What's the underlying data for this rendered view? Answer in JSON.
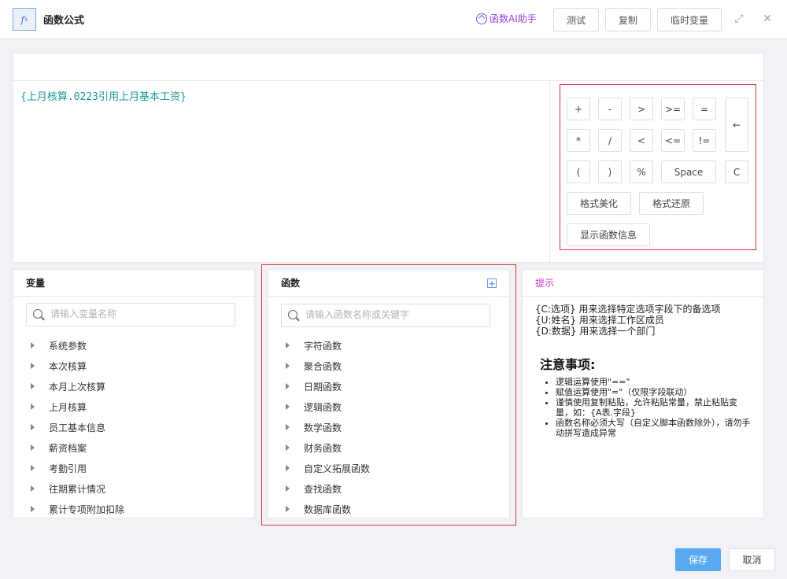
{
  "header": {
    "icon_text": "f",
    "icon_sup": "x",
    "title": "函数公式",
    "ai_assistant": "函数AI助手",
    "buttons": [
      "测试",
      "复制",
      "临时变量"
    ],
    "expand_glyph": "⤢",
    "close_glyph": "✕"
  },
  "editor": {
    "formula": "{上月核算.0223引用上月基本工资}"
  },
  "keypad": {
    "keys": [
      "+",
      "-",
      ">",
      ">=",
      "=",
      "*",
      "/",
      "<",
      "<=",
      "!=",
      "(",
      ")",
      "%",
      "Space",
      "C"
    ],
    "backspace": "←",
    "format_beautify": "格式美化",
    "format_restore": "格式还原",
    "show_function_info": "显示函数信息"
  },
  "variables": {
    "title": "变量",
    "search_placeholder": "请输入变量名称",
    "items": [
      "系统参数",
      "本次核算",
      "本月上次核算",
      "上月核算",
      "员工基本信息",
      "薪资档案",
      "考勤引用",
      "往期累计情况",
      "累计专项附加扣除"
    ]
  },
  "functions": {
    "title": "函数",
    "add_glyph": "+",
    "search_placeholder": "请输入函数名称或关键字",
    "items": [
      "字符函数",
      "聚合函数",
      "日期函数",
      "逻辑函数",
      "数学函数",
      "财务函数",
      "自定义拓展函数",
      "查找函数",
      "数据库函数"
    ]
  },
  "hints": {
    "title": "提示",
    "lines": [
      "{C:选项} 用来选择特定选项字段下的备选项",
      "{U:姓名} 用来选择工作区成员",
      "{D:数据} 用来选择一个部门"
    ],
    "notice_title": "注意事项:",
    "notices": [
      "逻辑运算使用\"==\"",
      "赋值运算使用\"=\"（仅限字段联动）",
      "谨慎使用复制粘贴，允许粘贴常量，禁止粘贴变量，如：{A表.字段}",
      "函数名称必须大写（自定义脚本函数除外），请勿手动拼写造成异常"
    ]
  },
  "footer": {
    "save": "保存",
    "cancel": "取消"
  }
}
